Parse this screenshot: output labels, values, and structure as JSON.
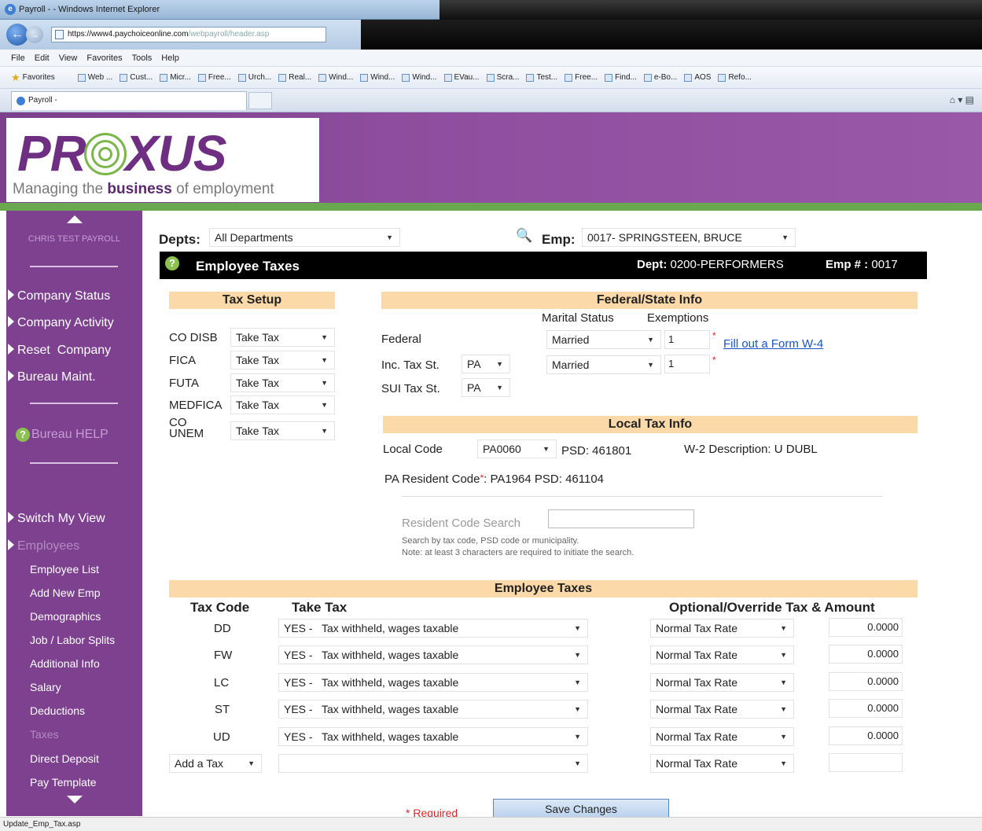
{
  "browser": {
    "window_title": "Payroll - - Windows Internet Explorer",
    "url_prefix": "https://",
    "url_host": "www4.paychoiceonline.com",
    "url_path": "/webpayroll/header.asp",
    "menu": [
      "File",
      "Edit",
      "View",
      "Favorites",
      "Tools",
      "Help"
    ],
    "favorites_label": "Favorites",
    "favorites_items": [
      "Web ...",
      "Cust...",
      "Micr...",
      "Free...",
      "Urch...",
      "Real...",
      "Wind...",
      "Wind...",
      "Wind...",
      "EVau...",
      "Scra...",
      "Test...",
      "Free...",
      "Find...",
      "e-Bo...",
      "AOS",
      "Refo..."
    ],
    "tab_title": "Payroll -",
    "status_text": "Update_Emp_Tax.asp"
  },
  "banner": {
    "logo_left": "PR",
    "logo_right": "XUS",
    "tagline_pre": "Managing the ",
    "tagline_bold": "business",
    "tagline_post": " of employment"
  },
  "sidebar": {
    "client_name": "CHRIS TEST PAYROLL",
    "links": [
      "Company Status",
      "Company Activity",
      "Reset  Company",
      "Bureau Maint."
    ],
    "help_label": "Bureau HELP",
    "switch_view": "Switch My View",
    "employees_label": "Employees",
    "employee_items": [
      "Employee List",
      "Add New Emp",
      "Demographics",
      "Job / Labor Splits",
      "Additional Info",
      "Salary",
      "Deductions",
      "Taxes",
      "Direct Deposit",
      "Pay Template"
    ]
  },
  "filters": {
    "depts_label": "Depts:",
    "depts_value": "All Departments",
    "emp_label": "Emp:",
    "emp_value": "0017- SPRINGSTEEN, BRUCE"
  },
  "header": {
    "title": "Employee Taxes",
    "dept_label": "Dept:",
    "dept_value": " 0200-PERFORMERS",
    "emp_num_label": "Emp # :",
    "emp_num_value": " 0017"
  },
  "tax_setup": {
    "title": "Tax Setup",
    "rows": [
      {
        "label": "CO DISB",
        "value": "Take Tax"
      },
      {
        "label": "FICA",
        "value": "Take Tax"
      },
      {
        "label": "FUTA",
        "value": "Take Tax"
      },
      {
        "label": "MEDFICA",
        "value": "Take Tax"
      },
      {
        "label": "CO\nUNEM",
        "value": "Take Tax"
      }
    ]
  },
  "federal_state": {
    "title": "Federal/State Info",
    "marital_status_hdr": "Marital Status",
    "exemptions_hdr": "Exemptions",
    "federal_label": "Federal",
    "inc_tax_label": "Inc. Tax St.",
    "inc_tax_value": "PA",
    "sui_tax_label": "SUI Tax St.",
    "sui_tax_value": "PA",
    "federal_marital": "Married",
    "federal_exemptions": "1",
    "state_marital": "Married",
    "state_exemptions": "1",
    "w4_link": "Fill out a Form W-4"
  },
  "local_tax": {
    "title": "Local Tax Info",
    "local_code_label": "Local Code",
    "local_code_value": "PA0060",
    "psd": "PSD: 461801",
    "w2_desc": "W-2 Description: U DUBL",
    "pa_resident_label": "PA Resident Code",
    "pa_resident_value": ": PA1964 PSD: 461104",
    "search_label": "Resident Code Search",
    "search_value": "",
    "note1": "Search by tax code, PSD code or municipality.",
    "note2": "Note: at least 3 characters are required to initiate the search."
  },
  "employee_taxes": {
    "title": "Employee Taxes",
    "col_tax_code": "Tax Code",
    "col_take_tax": "Take Tax",
    "col_optional": "Optional/Override Tax & Amount",
    "rows": [
      {
        "code": "DD",
        "take_tax": "YES -   Tax withheld, wages taxable",
        "rate": "Normal Tax Rate",
        "amount": "0.0000"
      },
      {
        "code": "FW",
        "take_tax": "YES -   Tax withheld, wages taxable",
        "rate": "Normal Tax Rate",
        "amount": "0.0000"
      },
      {
        "code": "LC",
        "take_tax": "YES -   Tax withheld, wages taxable",
        "rate": "Normal Tax Rate",
        "amount": "0.0000"
      },
      {
        "code": "ST",
        "take_tax": "YES -   Tax withheld, wages taxable",
        "rate": "Normal Tax Rate",
        "amount": "0.0000"
      },
      {
        "code": "UD",
        "take_tax": "YES -   Tax withheld, wages taxable",
        "rate": "Normal Tax Rate",
        "amount": "0.0000"
      }
    ],
    "add_tax_label": "Add a Tax",
    "add_rate": "Normal Tax Rate",
    "add_amount": ""
  },
  "footer": {
    "required_label": "* Required",
    "save_label": "Save Changes"
  }
}
